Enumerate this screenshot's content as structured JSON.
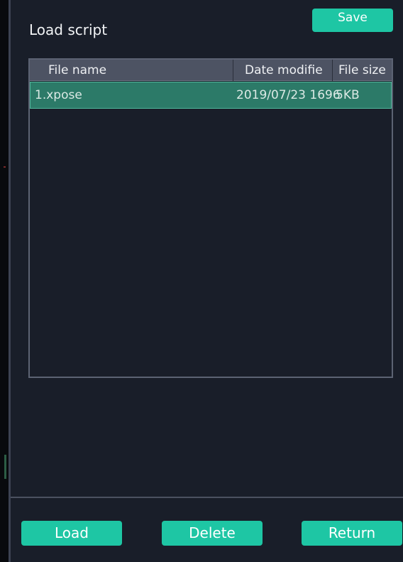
{
  "dialog": {
    "title": "Load script",
    "save_label": "Save"
  },
  "file_table": {
    "columns": [
      "File name",
      "Date modifie",
      "File size"
    ],
    "rows": [
      {
        "name": "1.xpose",
        "date": "2019/07/23 1696",
        "size": "5KB",
        "selected": true
      }
    ]
  },
  "footer": {
    "load_label": "Load",
    "delete_label": "Delete",
    "return_label": "Return"
  },
  "colors": {
    "accent": "#1ec6a4",
    "background": "#191e29",
    "header": "#4d5363",
    "selected_row": "#2c7a68"
  }
}
